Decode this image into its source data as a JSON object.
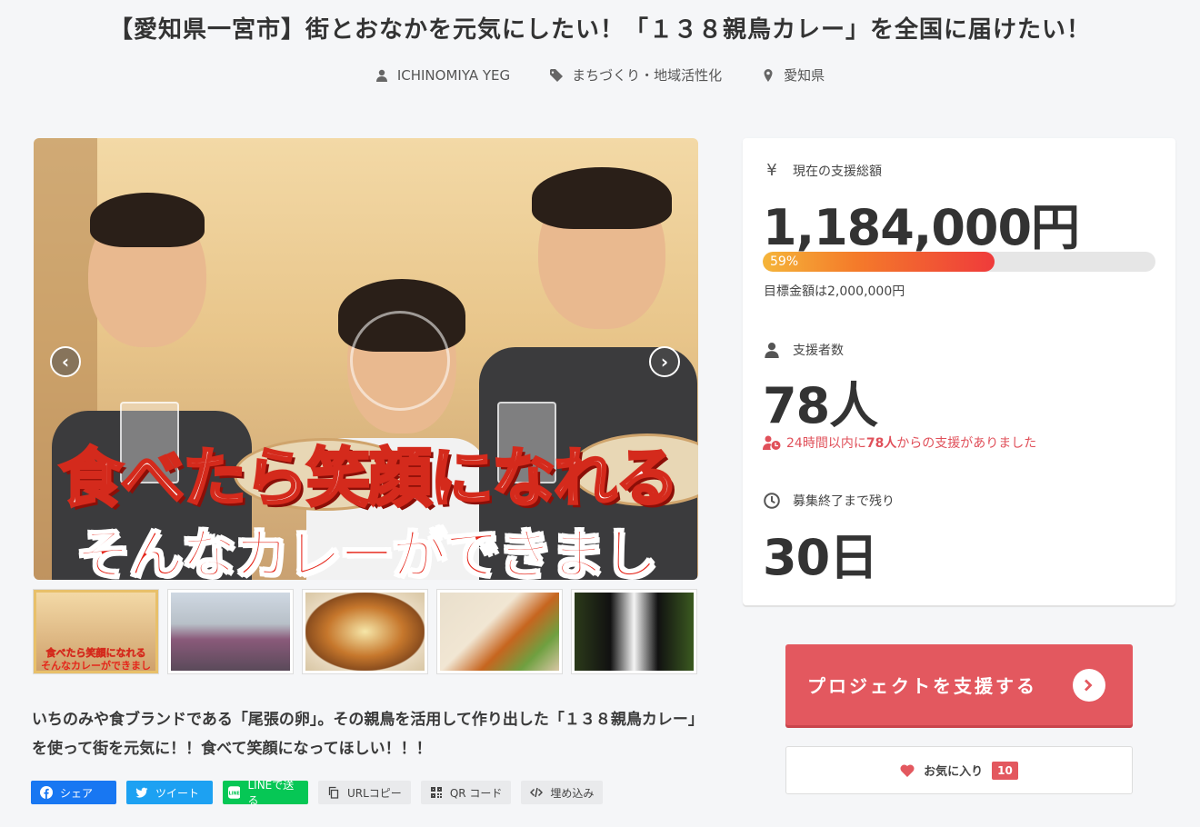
{
  "project": {
    "title": "【愛知県一宮市】街とおなかを元気にしたい！「１３８親鳥カレー」を全国に届けたい！",
    "owner": "ICHINOMIYA YEG",
    "category": "まちづくり・地域活性化",
    "location": "愛知県"
  },
  "hero": {
    "caption_line1": "食べたら笑顔になれる",
    "caption_line2": "そんなカレーができました！",
    "prev_icon": "chevron-left-icon",
    "next_icon": "chevron-right-icon"
  },
  "thumbnails": [
    {
      "caption1": "食べたら笑顔になれる",
      "caption2": "そんなカレーができました！"
    },
    {
      "caption1": "",
      "caption2": ""
    },
    {
      "caption1": "",
      "caption2": ""
    },
    {
      "caption1": "",
      "caption2": ""
    },
    {
      "caption1": "",
      "caption2": ""
    }
  ],
  "description": "いちのみや食ブランドである「尾張の卵」。その親鳥を活用して作り出した「１３８親鳥カレー」を使って街を元気に！！食べて笑顔になってほしい！！！",
  "share": {
    "facebook": "シェア",
    "twitter": "ツイート",
    "line": "LINEで送る",
    "url_copy": "URLコピー",
    "qr": "QR コード",
    "embed": "埋め込み"
  },
  "stats": {
    "amount_label": "現在の支援総額",
    "amount": "1,184,000円",
    "progress_percent": 59,
    "progress_label": "59%",
    "goal": "目標金額は2,000,000円",
    "supporters_label": "支援者数",
    "supporters": "78人",
    "recent_prefix": "24時間以内に",
    "recent_count": "78人",
    "recent_suffix": "からの支援がありました",
    "remaining_label": "募集終了まで残り",
    "remaining": "30日"
  },
  "actions": {
    "support_label": "プロジェクトを支援する",
    "favorite_label": "お気に入り",
    "favorite_count": "10"
  },
  "colors": {
    "accent": "#e3585f",
    "facebook": "#1877f2",
    "twitter": "#1da1f2",
    "line": "#06c755"
  }
}
